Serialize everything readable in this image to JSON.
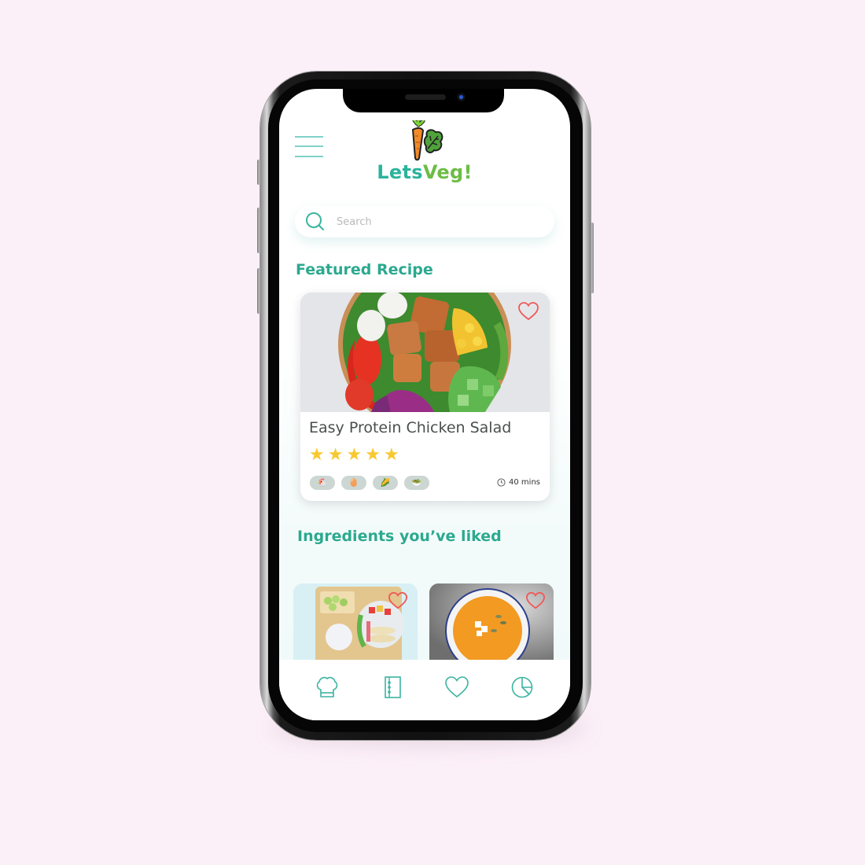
{
  "app": {
    "brand_part1": "Lets",
    "brand_part2": "Veg!",
    "brand_colors": {
      "primary": "#2bb39c",
      "secondary": "#6cbd45"
    }
  },
  "search": {
    "placeholder": "Search",
    "value": ""
  },
  "featured": {
    "section_title": "Featured Recipe",
    "recipe": {
      "title": "Easy Protein Chicken Salad",
      "rating": 5,
      "rating_max": 5,
      "stars": [
        "★",
        "★",
        "★",
        "★",
        "★"
      ],
      "ingredient_tags": [
        {
          "icon": "chicken-icon",
          "glyph": "🐔"
        },
        {
          "icon": "egg-icon",
          "glyph": "🥚"
        },
        {
          "icon": "corn-icon",
          "glyph": "🌽"
        },
        {
          "icon": "salad-bowl-icon",
          "glyph": "🥗"
        }
      ],
      "time": "40 mins",
      "favorited": false
    }
  },
  "liked": {
    "section_title": "Ingredients you’ve liked",
    "items": [
      {
        "name": "bento-tray",
        "favorited": false
      },
      {
        "name": "pumpkin-soup",
        "favorited": false
      }
    ]
  },
  "bottom_nav": [
    {
      "id": "recipes",
      "icon": "chef-hat-icon"
    },
    {
      "id": "menu",
      "icon": "notebook-icon"
    },
    {
      "id": "favorites",
      "icon": "heart-icon"
    },
    {
      "id": "stats",
      "icon": "pie-chart-icon"
    }
  ],
  "colors": {
    "accent": "#2ba98f",
    "heart": "#ef5a5a",
    "star": "#f7c830",
    "background": "#fcf0f8"
  }
}
